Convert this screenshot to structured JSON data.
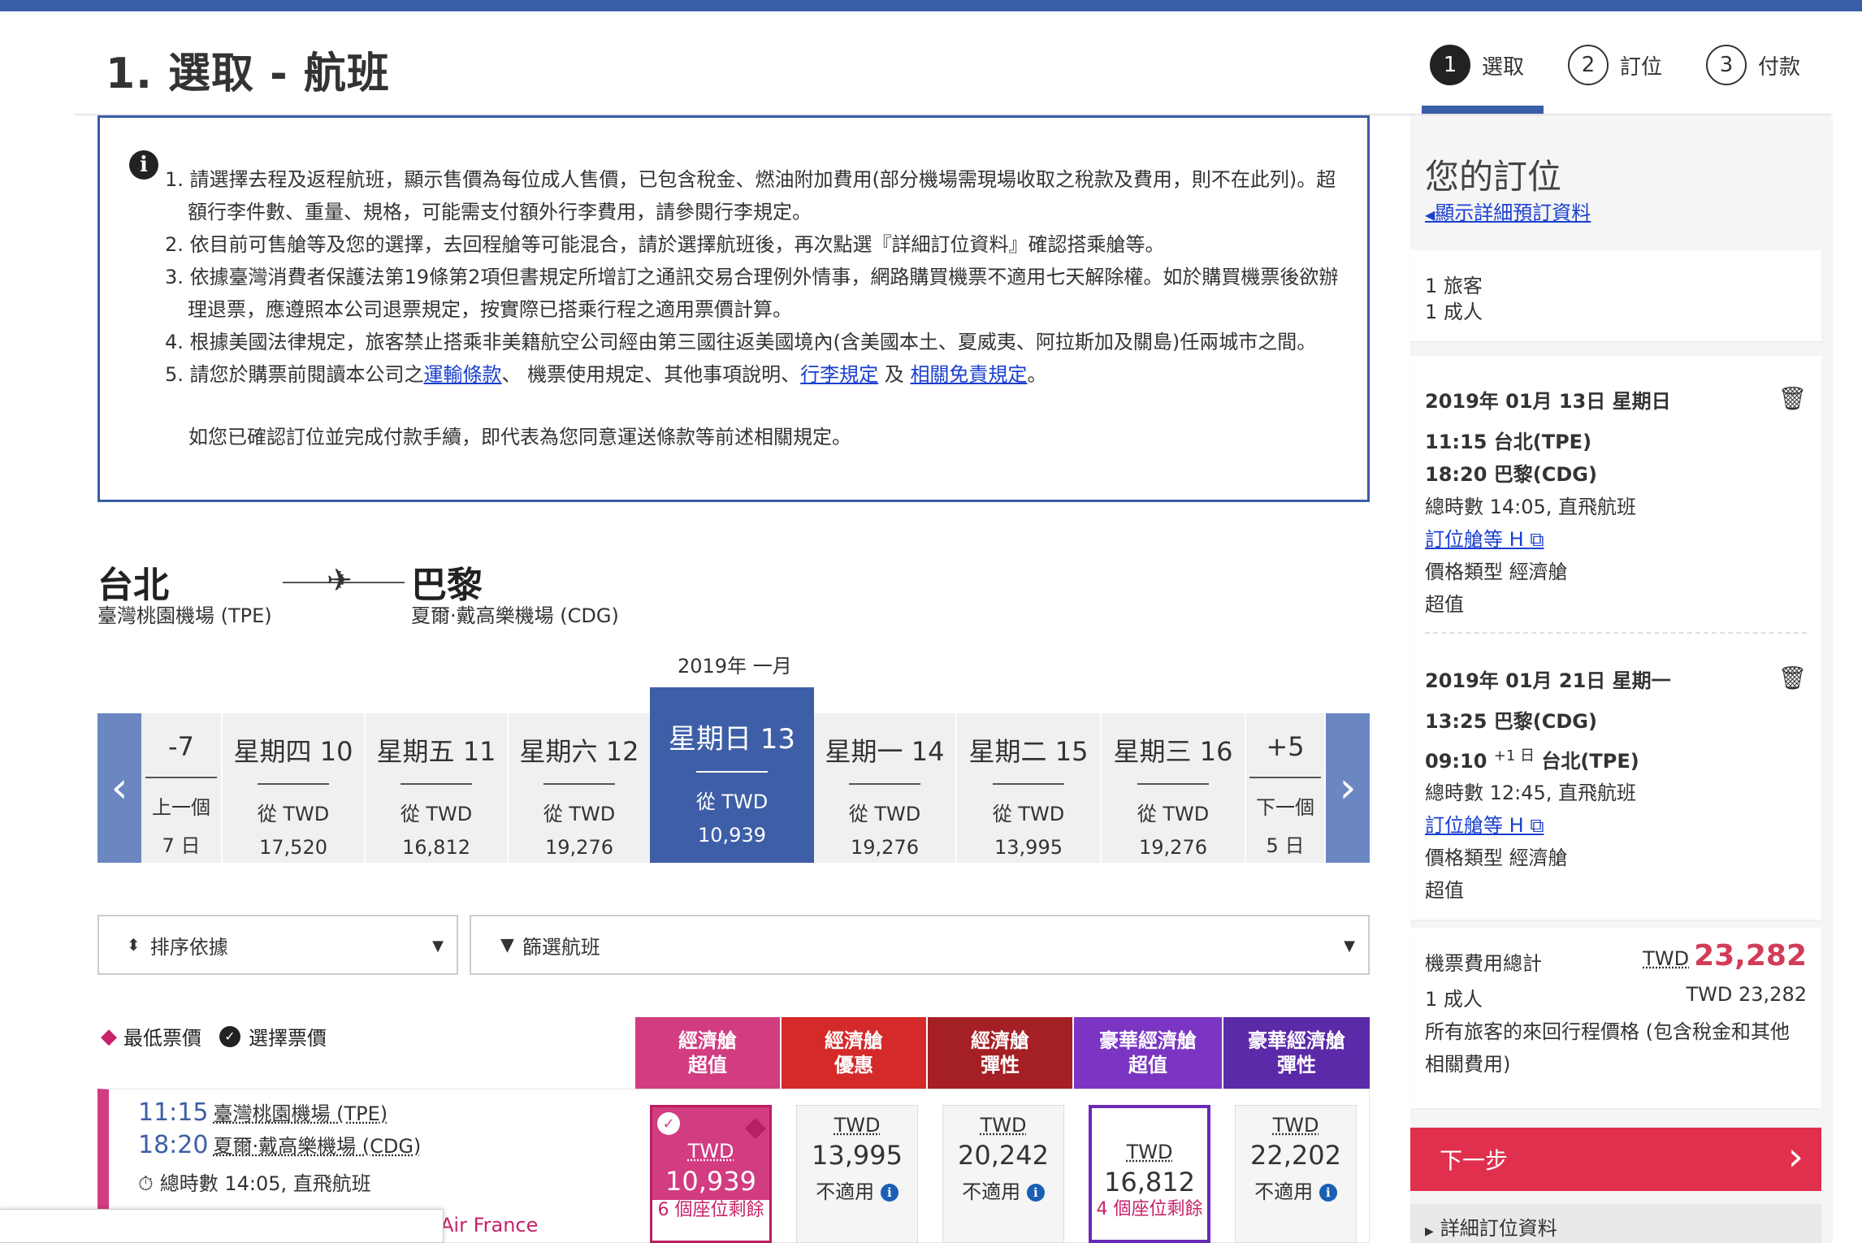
{
  "header": {
    "title": "1. 選取 - 航班",
    "steps": [
      {
        "num": "1",
        "label": "選取"
      },
      {
        "num": "2",
        "label": "訂位"
      },
      {
        "num": "3",
        "label": "付款"
      }
    ]
  },
  "notice": {
    "items": [
      "1. 請選擇去程及返程航班，顯示售價為每位成人售價，已包含稅金、燃油附加費用(部分機場需現場收取之稅款及費用，則不在此列)。超額行李件數、重量、規格，可能需支付額外行李費用，請參閱行李規定。",
      "2. 依目前可售艙等及您的選擇，去回程艙等可能混合，請於選擇航班後，再次點選『詳細訂位資料』確認搭乘艙等。",
      "3. 依據臺灣消費者保護法第19條第2項但書規定所增訂之通訊交易合理例外情事，網路購買機票不適用七天解除權。如於購買機票後欲辦理退票，應遵照本公司退票規定，按實際已搭乘行程之適用票價計算。",
      "4. 根據美國法律規定，旅客禁止搭乘非美籍航空公司經由第三國往返美國境內(含美國本土、夏威夷、阿拉斯加及關島)任兩城市之間。"
    ],
    "item5_prefix": "5. 請您於購票前閱讀本公司之",
    "link_transport": "運輸條款",
    "item5_mid1": "、 機票使用規定、其他事項說明、",
    "link_baggage": "行李規定",
    "item5_mid2": " 及 ",
    "link_disclaimer": "相關免責規定",
    "item5_end": "。",
    "confirm": "如您已確認訂位並完成付款手續，即代表為您同意運送條款等前述相關規定。"
  },
  "route": {
    "origin_city": "台北",
    "origin_airport": "臺灣桃園機場 (TPE)",
    "dest_city": "巴黎",
    "dest_airport": "夏爾·戴高樂機場 (CDG)"
  },
  "month_label": "2019年 一月",
  "dates": [
    {
      "day": "-7",
      "from": "上一個",
      "price": "7 日"
    },
    {
      "day": "星期四 10",
      "from": "從 TWD",
      "price": "17,520"
    },
    {
      "day": "星期五 11",
      "from": "從 TWD",
      "price": "16,812"
    },
    {
      "day": "星期六 12",
      "from": "從 TWD",
      "price": "19,276"
    },
    {
      "day": "星期日 13",
      "from": "從 TWD",
      "price": "10,939"
    },
    {
      "day": "星期一 14",
      "from": "從 TWD",
      "price": "19,276"
    },
    {
      "day": "星期二 15",
      "from": "從 TWD",
      "price": "13,995"
    },
    {
      "day": "星期三 16",
      "from": "從 TWD",
      "price": "19,276"
    },
    {
      "day": "+5",
      "from": "下一個",
      "price": "5 日"
    }
  ],
  "sort_label": "排序依據",
  "filter_label": "篩選航班",
  "legend": {
    "lowest": "最低票價",
    "selected": "選擇票價"
  },
  "cabins": [
    {
      "line1": "經濟艙",
      "line2": "超值",
      "color": "#d23c80"
    },
    {
      "line1": "經濟艙",
      "line2": "優惠",
      "color": "#d42a2a"
    },
    {
      "line1": "經濟艙",
      "line2": "彈性",
      "color": "#a52025"
    },
    {
      "line1": "豪華經濟艙",
      "line2": "超值",
      "color": "#7b35c2"
    },
    {
      "line1": "豪華經濟艙",
      "line2": "彈性",
      "color": "#5b2aa8"
    }
  ],
  "flight": {
    "dep_time": "11:15",
    "dep_airport": "臺灣桃園機場 (TPE)",
    "arr_time": "18:20",
    "arr_airport": "夏爾·戴高樂機場 (CDG)",
    "duration": "總時數 14:05, 直飛航班",
    "airline": "Air France"
  },
  "fares": [
    {
      "cur": "TWD",
      "amount": "10,939",
      "note": "6 個座位剩餘"
    },
    {
      "cur": "TWD",
      "amount": "13,995",
      "note": "不適用"
    },
    {
      "cur": "TWD",
      "amount": "20,242",
      "note": "不適用"
    },
    {
      "cur": "TWD",
      "amount": "16,812",
      "note": "4 個座位剩餘"
    },
    {
      "cur": "TWD",
      "amount": "22,202",
      "note": "不適用"
    }
  ],
  "sidebar": {
    "title": "您的訂位",
    "details_link": "顯示詳細預訂資料",
    "travelers": "1 旅客",
    "adults": "1 成人",
    "outbound": {
      "date": "2019年 01月 13日 星期日",
      "dep": "11:15 台北(TPE)",
      "arr": "18:20 巴黎(CDG)",
      "duration": "總時數 14:05, 直飛航班",
      "class_link": "訂位艙等 H",
      "fare_type": "價格類型 經濟艙",
      "fare_name": "超值"
    },
    "inbound": {
      "date": "2019年 01月 21日 星期一",
      "dep": "13:25 巴黎(CDG)",
      "arr_time": "09:10",
      "arr_plus": "+1 日",
      "arr_city": "台北(TPE)",
      "duration": "總時數 12:45, 直飛航班",
      "class_link": "訂位艙等 H",
      "fare_type": "價格類型 經濟艙",
      "fare_name": "超值"
    },
    "total_label": "機票費用總計",
    "total_cur": "TWD",
    "total_amount": "23,282",
    "adult_label": "1 成人",
    "adult_amount": "TWD 23,282",
    "total_note": "所有旅客的來回行程價格 (包含稅金和其他相關費用)",
    "next_label": "下一步",
    "detail_label": "詳細訂位資料"
  }
}
